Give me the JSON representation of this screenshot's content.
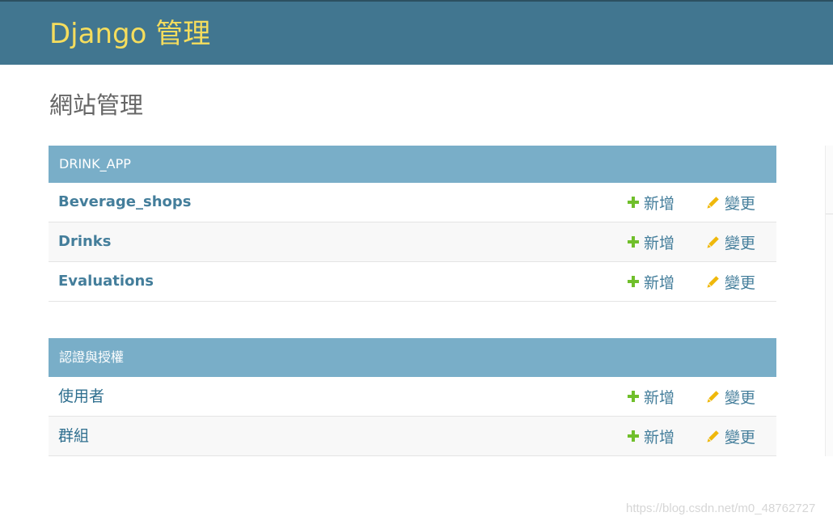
{
  "header": {
    "site_name": "Django 管理"
  },
  "page": {
    "title": "網站管理"
  },
  "modules": [
    {
      "caption": "DRINK_APP",
      "models": [
        {
          "name": "Beverage_shops",
          "add_label": "新增",
          "change_label": "變更"
        },
        {
          "name": "Drinks",
          "add_label": "新增",
          "change_label": "變更"
        },
        {
          "name": "Evaluations",
          "add_label": "新增",
          "change_label": "變更"
        }
      ]
    },
    {
      "caption": "認證與授權",
      "models": [
        {
          "name": "使用者",
          "add_label": "新增",
          "change_label": "變更"
        },
        {
          "name": "群組",
          "add_label": "新增",
          "change_label": "變更"
        }
      ]
    }
  ],
  "icons": {
    "add": "plus-icon",
    "change": "pencil-icon"
  },
  "colors": {
    "header_bg": "#417690",
    "site_name": "#f5dd5d",
    "caption_bg": "#79aec8",
    "link": "#447e9b",
    "add_icon": "#70bf2b",
    "change_icon": "#efb80b"
  },
  "watermark": "https://blog.csdn.net/m0_48762727"
}
